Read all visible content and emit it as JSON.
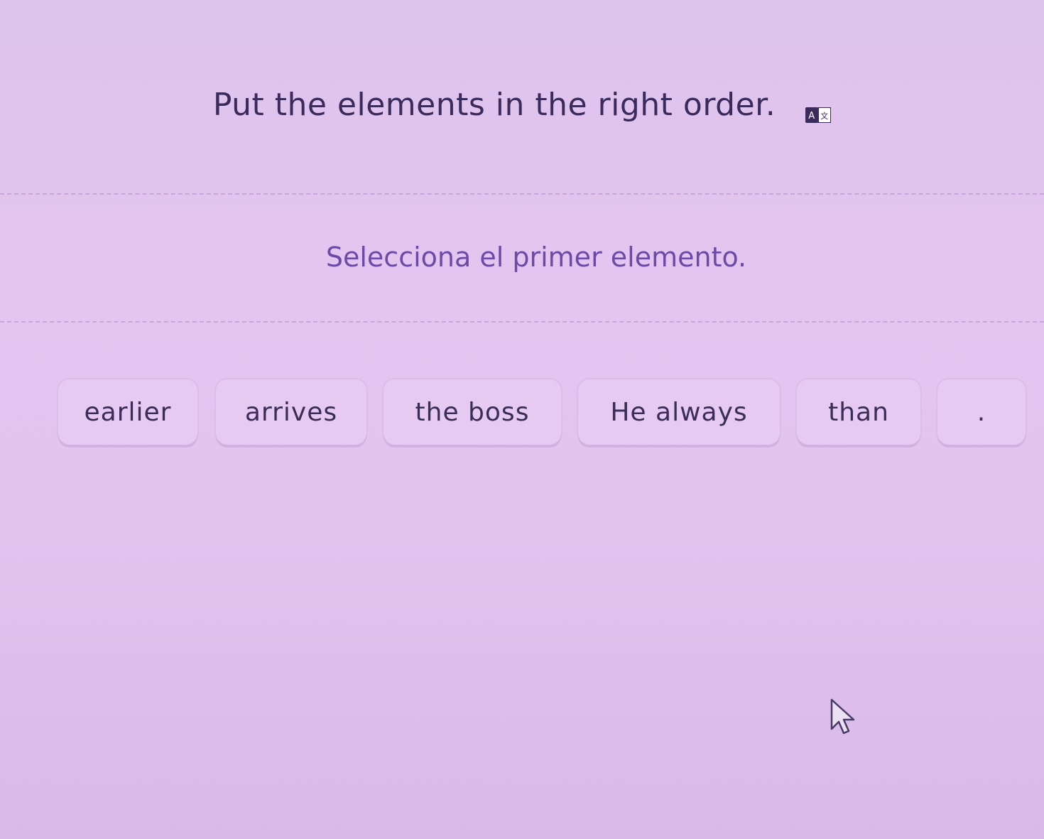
{
  "exercise": {
    "instruction": "Put the elements in the right order.",
    "translate_icon": "translate-icon",
    "prompt": "Selecciona el primer elemento."
  },
  "tiles": [
    {
      "label": "earlier"
    },
    {
      "label": "arrives"
    },
    {
      "label": "the boss"
    },
    {
      "label": "He always"
    },
    {
      "label": "than"
    },
    {
      "label": "."
    }
  ],
  "colors": {
    "background": "#e3c4ef",
    "tile": "#e6caf1",
    "text": "#3b2b5c",
    "prompt": "#6c4aa8"
  }
}
